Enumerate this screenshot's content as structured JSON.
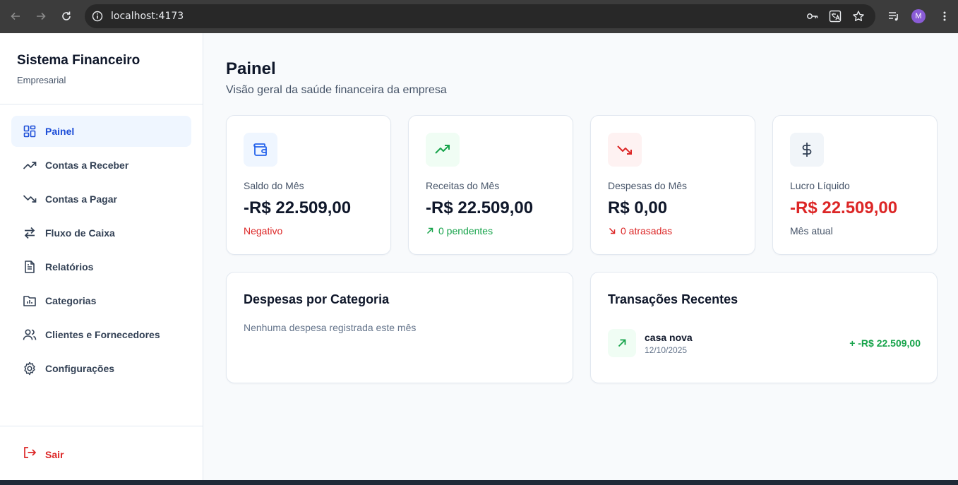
{
  "browser": {
    "url": "localhost:4173",
    "profile_initial": "M"
  },
  "sidebar": {
    "title": "Sistema Financeiro",
    "subtitle": "Empresarial",
    "items": [
      {
        "label": "Painel",
        "icon": "dashboard-icon",
        "active": true
      },
      {
        "label": "Contas a Receber",
        "icon": "trending-up-icon"
      },
      {
        "label": "Contas a Pagar",
        "icon": "trending-down-icon"
      },
      {
        "label": "Fluxo de Caixa",
        "icon": "arrows-left-right-icon"
      },
      {
        "label": "Relatórios",
        "icon": "file-text-icon"
      },
      {
        "label": "Categorias",
        "icon": "folder-chart-icon"
      },
      {
        "label": "Clientes e Fornecedores",
        "icon": "users-icon"
      },
      {
        "label": "Configurações",
        "icon": "gear-icon"
      }
    ],
    "logout_label": "Sair"
  },
  "page": {
    "title": "Painel",
    "subtitle": "Visão geral da saúde financeira da empresa"
  },
  "stats": [
    {
      "label": "Saldo do Mês",
      "value": "-R$ 22.509,00",
      "note": "Negativo",
      "icon": "wallet-icon"
    },
    {
      "label": "Receitas do Mês",
      "value": "-R$ 22.509,00",
      "note": "0 pendentes",
      "icon": "trending-up-icon"
    },
    {
      "label": "Despesas do Mês",
      "value": "R$ 0,00",
      "note": "0 atrasadas",
      "icon": "trending-down-icon"
    },
    {
      "label": "Lucro Líquido",
      "value": "-R$ 22.509,00",
      "note": "Mês atual",
      "icon": "dollar-icon"
    }
  ],
  "expenses_panel": {
    "title": "Despesas por Categoria",
    "empty_text": "Nenhuma despesa registrada este mês"
  },
  "transactions_panel": {
    "title": "Transações Recentes",
    "items": [
      {
        "description": "casa nova",
        "date": "12/10/2025",
        "amount": "+ -R$ 22.509,00",
        "icon": "arrow-up-right-icon"
      }
    ]
  },
  "colors": {
    "primary": "#1d4ed8",
    "active_bg": "#eff6ff",
    "positive": "#16a34a",
    "negative": "#dc2626",
    "text": "#0f172a",
    "muted": "#475569"
  }
}
